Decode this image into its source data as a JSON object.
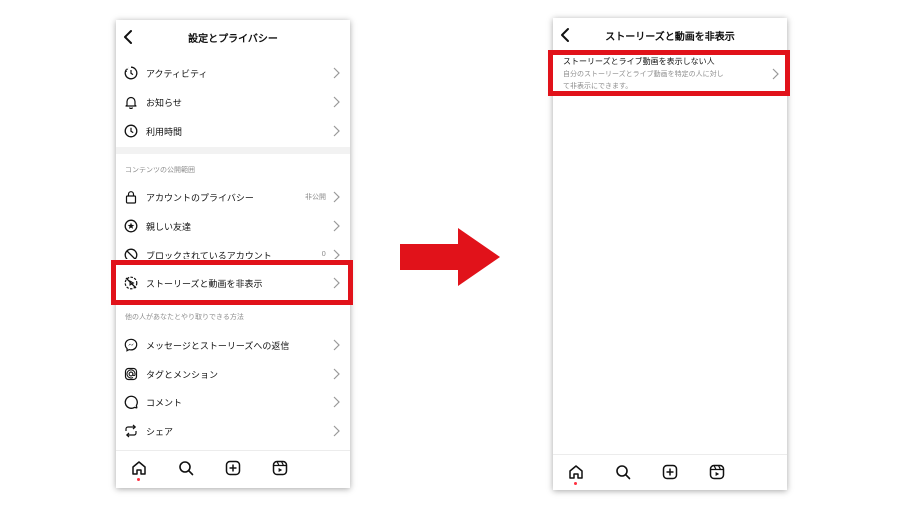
{
  "left_screen": {
    "title": "設定とプライバシー",
    "items_top": [
      {
        "label": "アクティビティ",
        "icon": "activity-icon"
      },
      {
        "label": "お知らせ",
        "icon": "bell-icon"
      },
      {
        "label": "利用時間",
        "icon": "clock-icon"
      }
    ],
    "section_visibility": "コンテンツの公開範囲",
    "items_visibility": [
      {
        "label": "アカウントのプライバシー",
        "value": "非公開",
        "icon": "lock-icon"
      },
      {
        "label": "親しい友達",
        "value": "",
        "icon": "star-circle-icon"
      },
      {
        "label": "ブロックされているアカウント",
        "value": "0",
        "icon": "block-icon"
      },
      {
        "label": "ストーリーズと動画を非表示",
        "value": "",
        "icon": "hide-story-icon"
      }
    ],
    "section_interaction": "他の人があなたとやり取りできる方法",
    "items_interaction": [
      {
        "label": "メッセージとストーリーズへの返信",
        "icon": "messenger-icon"
      },
      {
        "label": "タグとメンション",
        "icon": "mention-icon"
      },
      {
        "label": "コメント",
        "icon": "comment-icon"
      },
      {
        "label": "シェア",
        "icon": "share-icon"
      }
    ]
  },
  "right_screen": {
    "title": "ストーリーズと動画を非表示",
    "item_title": "ストーリーズとライブ動画を表示しない人",
    "item_desc_line1": "自分のストーリーズとライブ動画を特定の人に対し",
    "item_desc_line2": "て非表示にできます。"
  },
  "bottom_nav": [
    "home-icon",
    "search-icon",
    "create-icon",
    "reels-icon"
  ],
  "colors": {
    "highlight": "#e1121a",
    "notification_dot": "#ff3040",
    "secondary_text": "#8e8e8e"
  }
}
